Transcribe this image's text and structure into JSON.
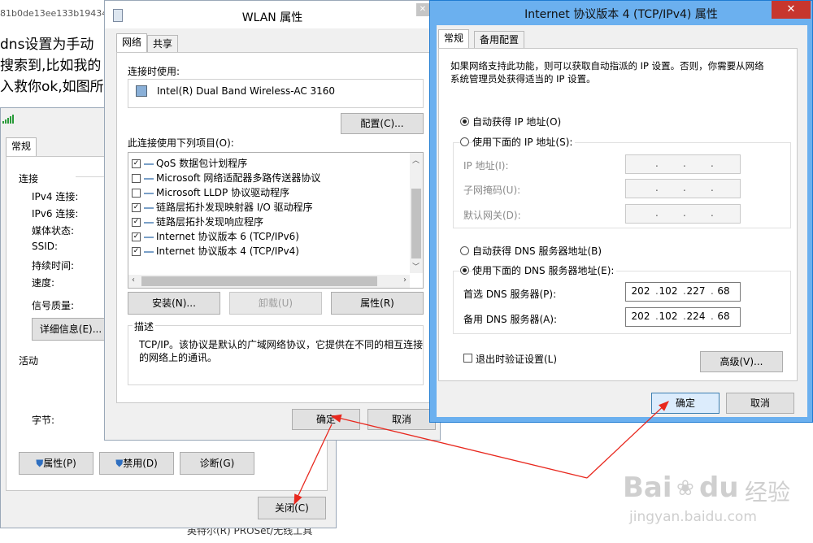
{
  "bg": {
    "tab_title": "81b0de13ee133b19434",
    "text_lines": [
      "dns设置为手动",
      "搜索到,比如我的",
      "入救你ok,如图所"
    ],
    "bottom_text": "英特尔(R) PROSet/无线工具"
  },
  "status_win": {
    "tab_general": "常规",
    "section_connection": "连接",
    "rows": [
      "IPv4 连接:",
      "IPv6 连接:",
      "媒体状态:",
      "SSID:",
      "持续时间:",
      "速度:"
    ],
    "signal_label": "信号质量:",
    "details_btn": "详细信息(E)...",
    "section_activity": "活动",
    "bytes_label": "字节:",
    "properties_btn": "属性(P)",
    "disable_btn": "禁用(D)",
    "diagnose_btn": "诊断(G)",
    "close_btn": "关闭(C)"
  },
  "wlan": {
    "title": "WLAN 属性",
    "tabs": [
      "网络",
      "共享"
    ],
    "connect_using_label": "连接时使用:",
    "adapter": "Intel(R) Dual Band Wireless-AC 3160",
    "configure_btn": "配置(C)...",
    "items_label": "此连接使用下列项目(O):",
    "items": [
      {
        "checked": true,
        "label": "QoS 数据包计划程序"
      },
      {
        "checked": false,
        "label": "Microsoft 网络适配器多路传送器协议"
      },
      {
        "checked": false,
        "label": "Microsoft LLDP 协议驱动程序"
      },
      {
        "checked": true,
        "label": "链路层拓扑发现映射器 I/O 驱动程序"
      },
      {
        "checked": true,
        "label": "链路层拓扑发现响应程序"
      },
      {
        "checked": true,
        "label": "Internet 协议版本 6 (TCP/IPv6)"
      },
      {
        "checked": true,
        "label": "Internet 协议版本 4 (TCP/IPv4)"
      }
    ],
    "install_btn": "安装(N)...",
    "uninstall_btn": "卸载(U)",
    "properties_btn": "属性(R)",
    "desc_label": "描述",
    "desc_text_1": "TCP/IP。该协议是默认的广域网络协议，它提供在不同的相互连接",
    "desc_text_2": "的网络上的通讯。",
    "ok_btn": "确定",
    "cancel_btn": "取消"
  },
  "ipv4": {
    "title": "Internet 协议版本 4 (TCP/IPv4) 属性",
    "close_glyph": "✕",
    "tabs": [
      "常规",
      "备用配置"
    ],
    "intro_1": "如果网络支持此功能，则可以获取自动指派的 IP 设置。否则，你需要从网络",
    "intro_2": "系统管理员处获得适当的 IP 设置。",
    "auto_ip": "自动获得 IP 地址(O)",
    "manual_ip": "使用下面的 IP 地址(S):",
    "ip_addr": "IP 地址(I):",
    "subnet": "子网掩码(U):",
    "gateway": "默认网关(D):",
    "auto_dns": "自动获得 DNS 服务器地址(B)",
    "manual_dns": "使用下面的 DNS 服务器地址(E):",
    "pref_dns": "首选 DNS 服务器(P):",
    "alt_dns": "备用 DNS 服务器(A):",
    "pref_dns_value": [
      "202",
      "102",
      "227",
      "68"
    ],
    "alt_dns_value": [
      "202",
      "102",
      "224",
      "68"
    ],
    "validate": "退出时验证设置(L)",
    "advanced_btn": "高级(V)...",
    "ok_btn": "确定",
    "cancel_btn": "取消"
  },
  "watermark": {
    "brand_1": "Bai",
    "brand_2": "du",
    "brand_cn": "经验",
    "url": "jingyan.baidu.com"
  },
  "colors": {
    "accent_border": "#1e7bd2",
    "arrow": "#e8281e"
  }
}
